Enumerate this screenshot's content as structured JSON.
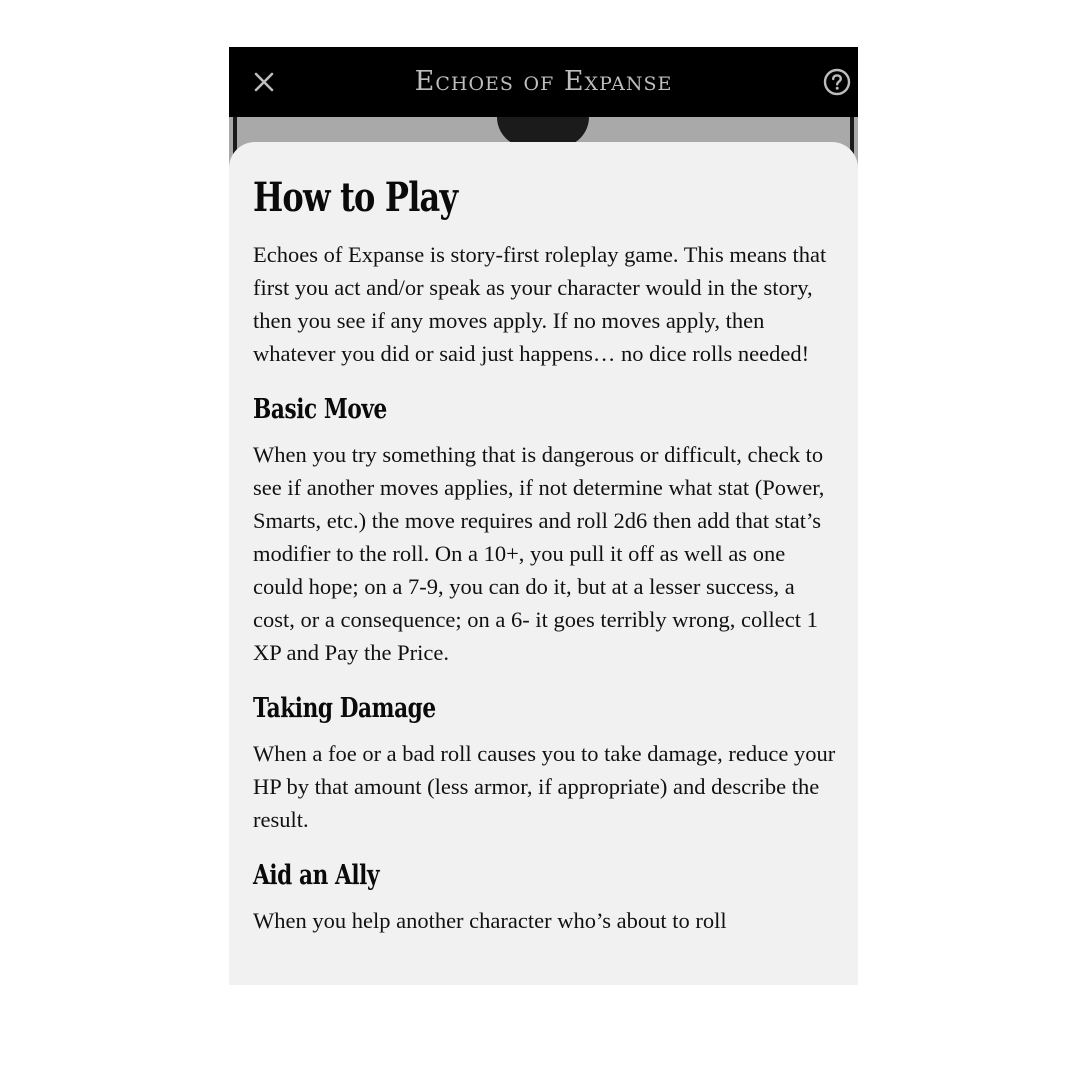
{
  "header": {
    "title": "Echoes of Expanse",
    "close_icon": "close-icon",
    "help_icon": "help-circle-icon"
  },
  "page": {
    "title": "How to Play",
    "intro": "Echoes of Expanse is story-first roleplay game. This means that first you act and/or speak as your character would in the story, then you see if any moves apply. If no moves apply, then whatever you did or said just happens… no dice rolls needed!",
    "sections": [
      {
        "heading": "Basic Move",
        "body": "When you try something that is dangerous or difficult, check to see if another moves applies, if not determine what stat (Power, Smarts, etc.) the move requires and roll 2d6 then add that stat’s modifier to the roll. On a 10+, you pull it off as well as one could hope; on a 7-9, you can do it, but at a lesser success, a cost, or a consequence; on a 6- it goes terribly wrong, collect 1 XP and Pay the Price."
      },
      {
        "heading": "Taking Damage",
        "body": "When a foe or a bad roll causes you to take damage, reduce your HP by that amount (less armor, if appropriate) and describe the result."
      },
      {
        "heading": "Aid an Ally",
        "body": "When you help another character who’s about to roll"
      }
    ]
  },
  "colors": {
    "header_bg": "#000000",
    "header_text": "#bdbdbd",
    "sheet_bg": "#f1f1f1",
    "text": "#111111"
  }
}
